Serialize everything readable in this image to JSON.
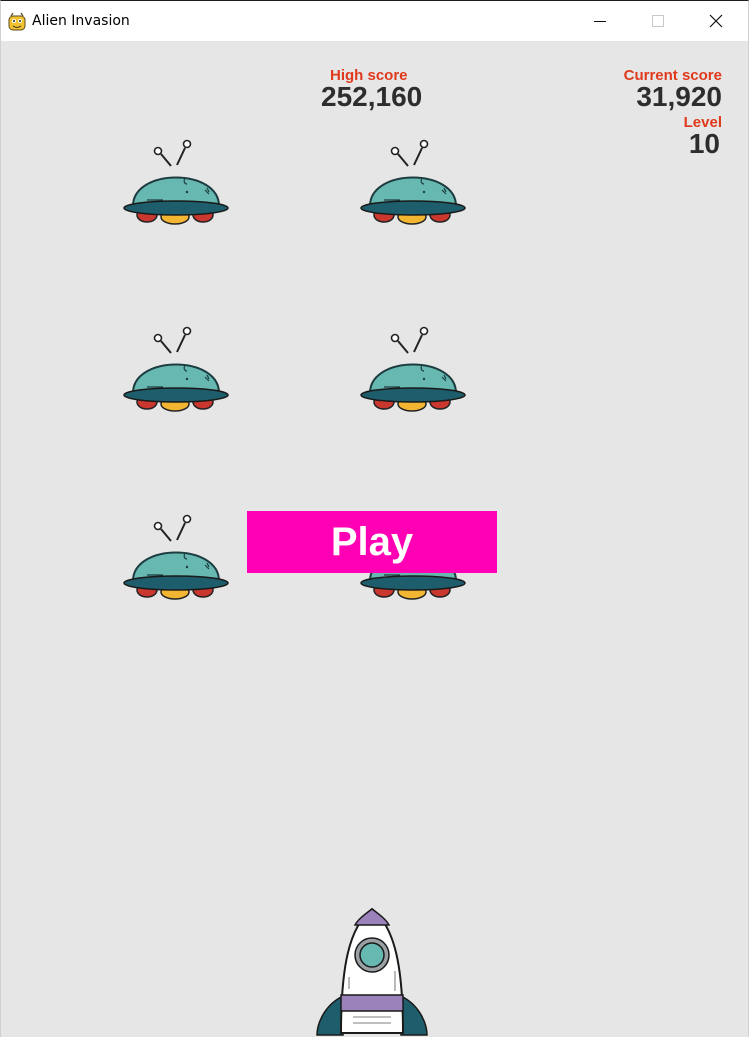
{
  "window": {
    "title": "Alien Invasion",
    "controls": [
      "minimize-icon",
      "maximize-icon",
      "close-icon"
    ]
  },
  "scoreboard": {
    "high_score_label": "High score",
    "high_score_value": "252,160",
    "current_score_label": "Current score",
    "current_score_value": "31,920",
    "level_label": "Level",
    "level_value": "10"
  },
  "play_button": {
    "label": "Play",
    "color": "#ff00b4"
  },
  "aliens": {
    "icon": "alien-ufo-icon",
    "count": 6
  },
  "player_ship": {
    "icon": "rocket-ship-icon"
  },
  "colors": {
    "background": "#e6e6e6",
    "score_label": "#e03a1c",
    "score_value": "#2d2d2d"
  }
}
